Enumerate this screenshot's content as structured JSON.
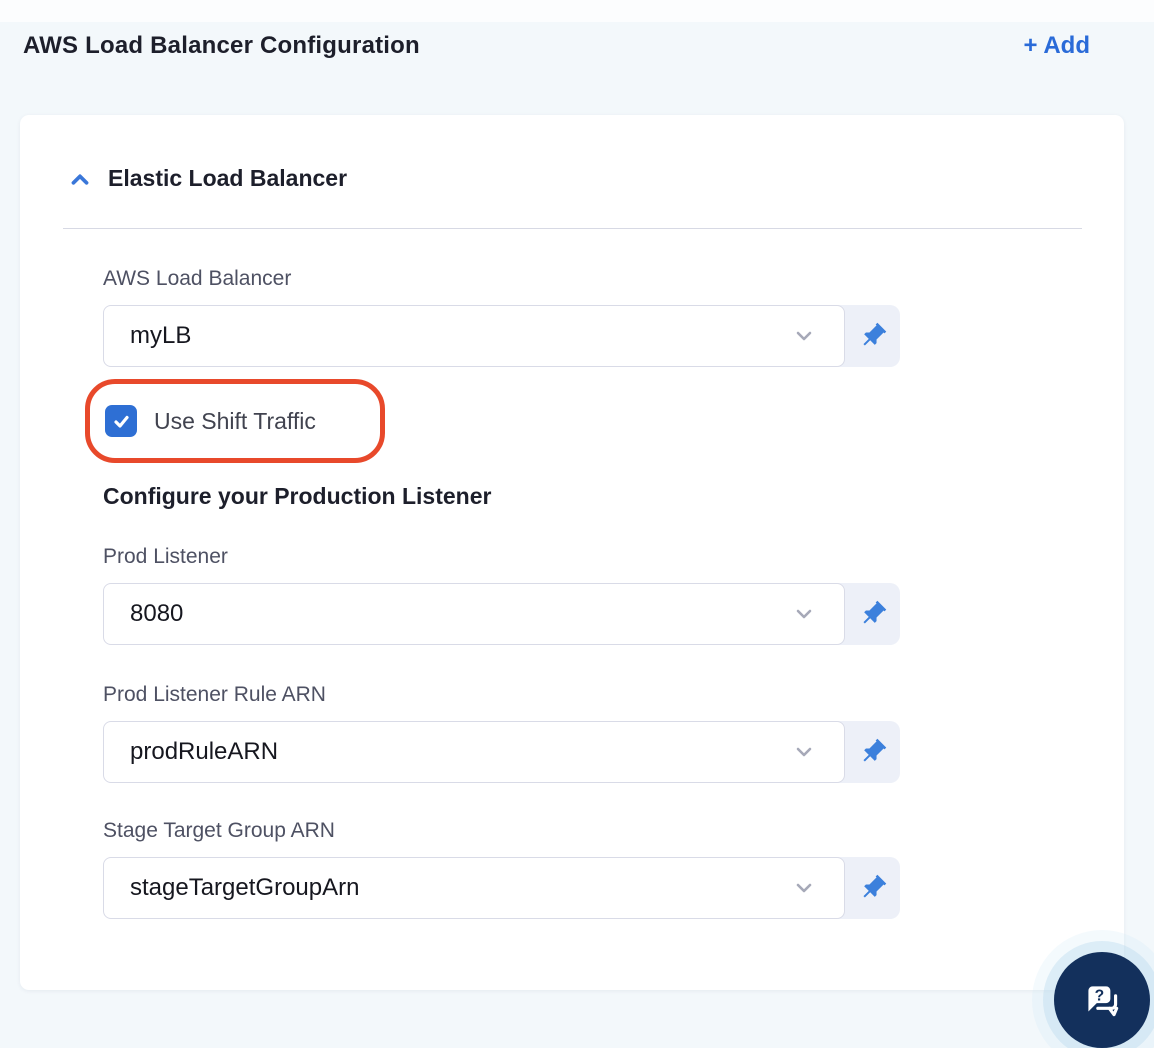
{
  "header": {
    "title": "AWS Load Balancer Configuration",
    "add_button": "+ Add"
  },
  "panel": {
    "section": {
      "title": "Elastic Load Balancer",
      "collapse_icon": "chevron-up-icon",
      "expanded": true
    },
    "aws_load_balancer": {
      "label": "AWS Load Balancer",
      "value": "myLB"
    },
    "use_shift_traffic": {
      "label": "Use Shift Traffic",
      "checked": true
    },
    "production_listener_heading": "Configure your Production Listener",
    "prod_listener": {
      "label": "Prod Listener",
      "value": "8080"
    },
    "prod_listener_rule_arn": {
      "label": "Prod Listener Rule ARN",
      "value": "prodRuleARN"
    },
    "stage_target_group_arn": {
      "label": "Stage Target Group ARN",
      "value": "stageTargetGroupArn"
    }
  },
  "icons": {
    "dropdown": "chevron-down-icon",
    "pin": "pushpin-icon",
    "help": "chat-question-icon",
    "check": "checkmark-icon"
  },
  "annotation": {
    "shape": "rounded-rectangle",
    "color": "#e8492b",
    "target": "use-shift-traffic-checkbox"
  },
  "colors": {
    "accent_blue": "#2a6bd8",
    "checkbox_blue": "#2e6fd4",
    "pin_blue": "#3c80dc",
    "annotation_red": "#e8492b",
    "help_navy": "#13305c",
    "page_bg": "#f3f8fb",
    "card_bg": "#ffffff"
  }
}
